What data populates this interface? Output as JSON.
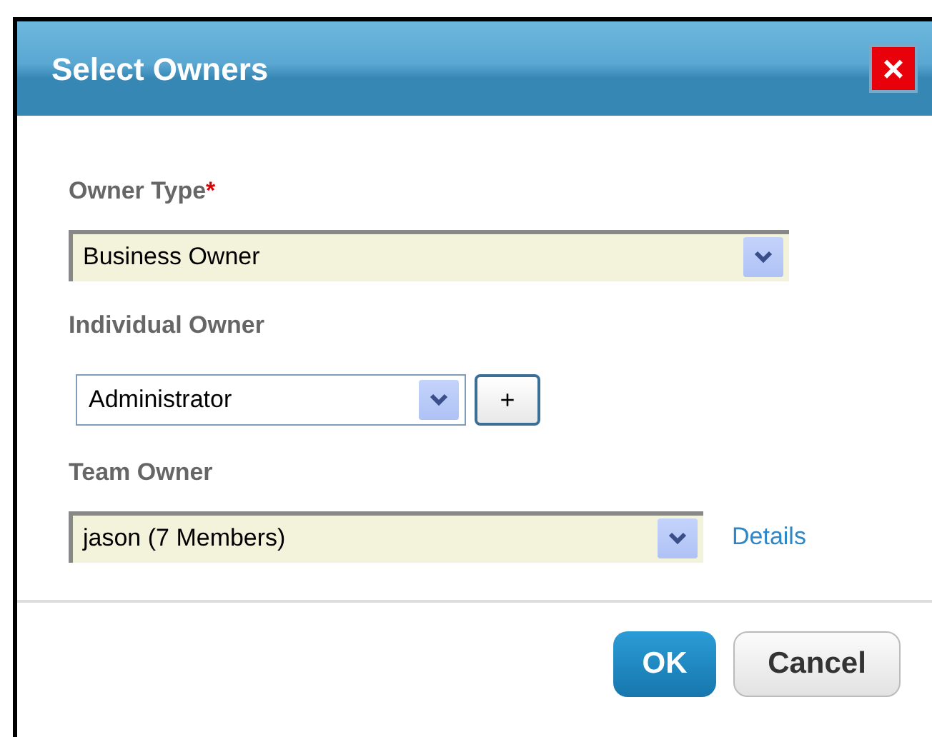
{
  "dialog": {
    "title": "Select Owners",
    "close_label": "×"
  },
  "fields": [
    {
      "label": "Owner Type",
      "required_mark": "*",
      "kind": "wide",
      "value": "Business Owner"
    },
    {
      "label": "Individual Owner",
      "kind": "compact",
      "value": "Administrator",
      "add_label": "+"
    },
    {
      "label": "Team Owner",
      "kind": "medium",
      "value": "jason (7 Members)",
      "link": "Details"
    }
  ],
  "buttons": [
    {
      "label": "OK",
      "kind": "primary"
    },
    {
      "label": "Cancel",
      "kind": "secondary"
    }
  ]
}
